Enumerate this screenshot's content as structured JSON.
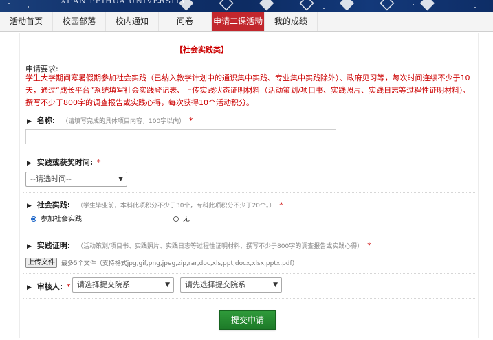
{
  "header": {
    "university": "XI'AN PEIHUA UNIVERSITY"
  },
  "nav": {
    "tabs": [
      {
        "label": "活动首页",
        "active": false
      },
      {
        "label": "校园部落",
        "active": false
      },
      {
        "label": "校内通知",
        "active": false
      },
      {
        "label": "问卷",
        "active": false
      },
      {
        "label": "申请二课活动积",
        "active": true
      },
      {
        "label": "我的成绩",
        "active": false
      }
    ]
  },
  "form": {
    "category": "【社会实践类】",
    "requirement_title": "申请要求:",
    "requirement_text": "学生大学期间寒暑假期参加社会实践（已纳入教学计划中的通识集中实践、专业集中实践除外）、政府见习等，每次时间连续不少于10天，通过“成长平台”系统填写社会实践登记表、上传实践状态证明材料（活动策划/项目书、实践照片、实践日志等过程性证明材料）、撰写不少于800字的调查报告或实践心得，每次获得10个活动积分。",
    "name": {
      "label": "名称:",
      "hint": "（请填写完成的具体项目内容，100字以内）",
      "required": "*",
      "value": ""
    },
    "time": {
      "label": "实践或获奖时间:",
      "required": "*",
      "selected": "--请选时间--"
    },
    "social": {
      "label": "社会实践:",
      "hint": "（学生毕业前，本科此项积分不少于30个，专科此项积分不少于20个。）",
      "required": "*",
      "options": [
        {
          "label": "参加社会实践",
          "checked": true
        },
        {
          "label": "无",
          "checked": false
        }
      ]
    },
    "proof": {
      "label": "实践证明:",
      "hint": "（活动策划/项目书、实践照片、实践日志等过程性证明材料、撰写不少于800字的调查报告或实践心得）",
      "required": "*",
      "upload_label": "上传文件",
      "upload_note": "最多5个文件（支持格式jpg,gif,png,jpeg,zip,rar,doc,xls,ppt,docx,xlsx,pptx,pdf）"
    },
    "reviewer": {
      "label": "审核人:",
      "required": "*",
      "dept_select": "请选择提交院系",
      "person_select": "请先选择提交院系"
    },
    "submit_label": "提交申请"
  },
  "colors": {
    "accent_red": "#c2272d",
    "requirement_red": "#cc0000",
    "submit_green": "#1d7a28"
  }
}
